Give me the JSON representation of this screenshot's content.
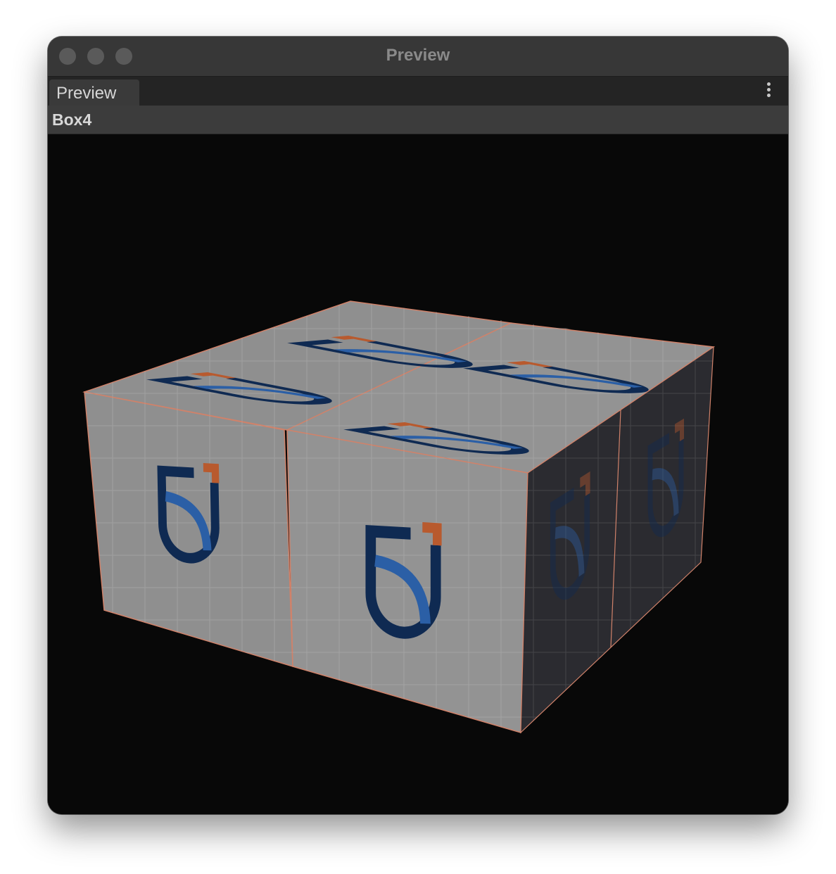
{
  "window": {
    "title": "Preview",
    "traffic_lights": [
      "close",
      "minimize",
      "zoom"
    ]
  },
  "tabs": [
    {
      "label": "Preview",
      "active": true
    }
  ],
  "menu": {
    "icon": "more-vertical-icon"
  },
  "object": {
    "name": "Box4"
  },
  "viewport": {
    "background": "#080808",
    "mesh_colors": {
      "face": "#8f8f8f",
      "face_lit": "#9a9a9a",
      "face_dark": "#2b2b30",
      "edge": "#d0826a",
      "logo_navy": "#0f2a52",
      "logo_blue": "#2b5fa6",
      "logo_orange": "#b85a2e"
    },
    "logo_icon": "shield-logo-icon",
    "boxes": 4
  }
}
